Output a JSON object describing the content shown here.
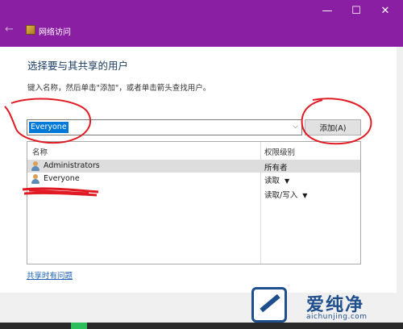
{
  "window": {
    "title": "网络访问",
    "controls": {
      "minimize": "—",
      "maximize": "☐",
      "close": "✕"
    },
    "back_glyph": "←",
    "accent_color": "#8b1fa3"
  },
  "main": {
    "heading": "选择要与其共享的用户",
    "instruction": "键入名称，然后单击\"添加\"，或者单击箭头查找用户。",
    "combo": {
      "value": "Everyone",
      "arrow": "⌵"
    },
    "add_button": "添加(A)"
  },
  "list": {
    "columns": {
      "name": "名称",
      "permission": "权限级别"
    },
    "rows": [
      {
        "name": "Administrators",
        "permission": "所有者",
        "caret": ""
      },
      {
        "name": "Everyone",
        "permission": "读取",
        "caret": "▼"
      },
      {
        "name": "",
        "permission": "读取/写入",
        "caret": "▼"
      }
    ]
  },
  "footer": {
    "link": "共享时有问题"
  },
  "watermark": {
    "brand": "爱纯净",
    "url": "aichunjing.com"
  }
}
